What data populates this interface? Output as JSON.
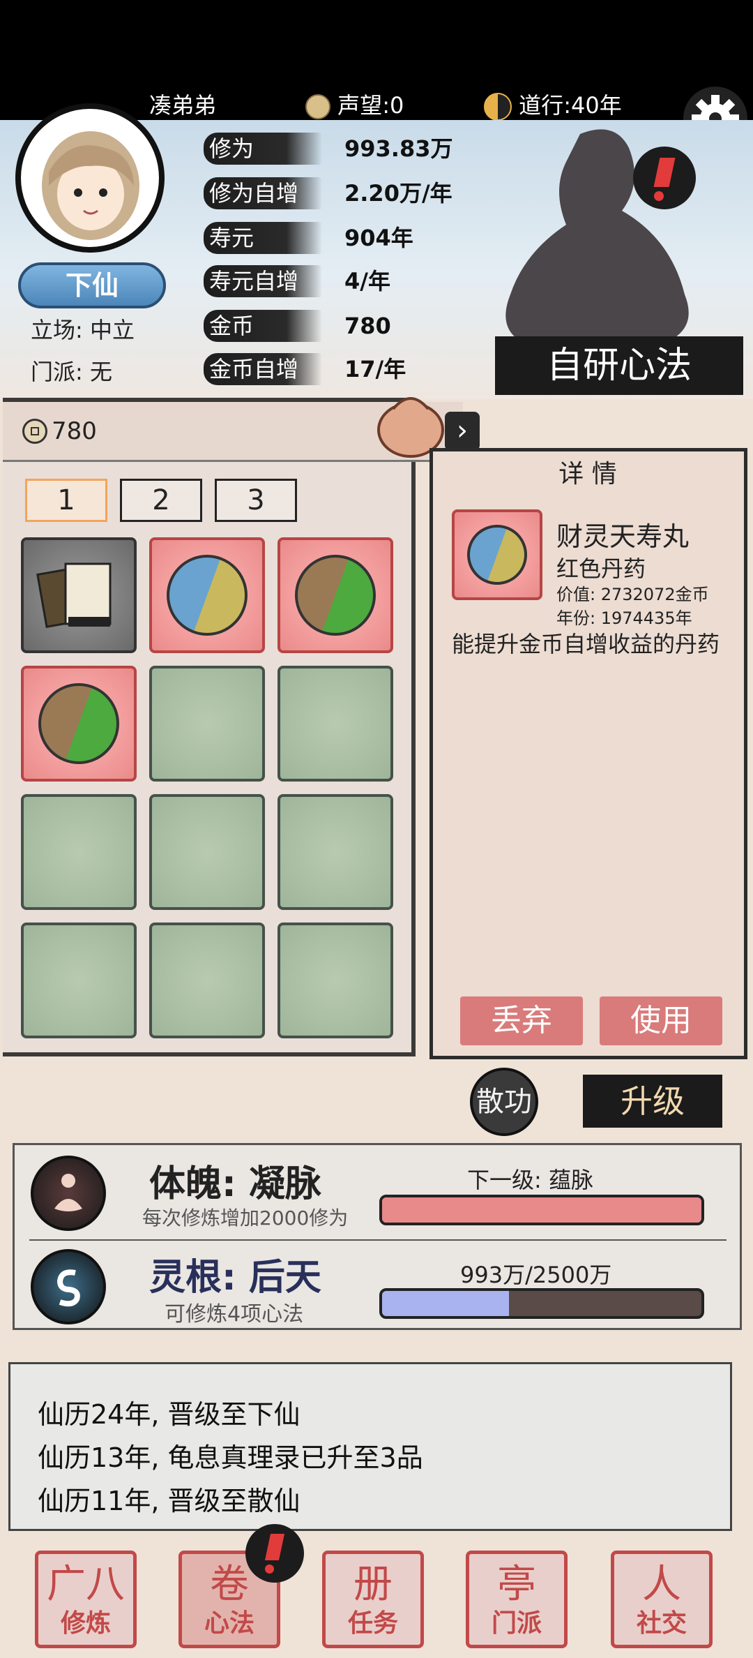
{
  "top": {
    "player_name": "凑弟弟",
    "reputation_label": "声望",
    "reputation_value": ":0",
    "dao_label": "道行",
    "dao_value": ":40年"
  },
  "profile": {
    "rank_badge": "下仙",
    "stance": "立场: 中立",
    "sect": "门派: 无"
  },
  "stats": [
    {
      "label": "修为",
      "value": "993.83万"
    },
    {
      "label": "修为自增",
      "value": "2.20万/年"
    },
    {
      "label": "寿元",
      "value": "904年"
    },
    {
      "label": "寿元自增",
      "value": "4/年"
    },
    {
      "label": "金币",
      "value": "780"
    },
    {
      "label": "金币自增",
      "value": "17/年"
    }
  ],
  "self_study_button": "自研心法",
  "inventory": {
    "coin_count": "780",
    "tabs": [
      "1",
      "2",
      "3"
    ],
    "active_tab": "1"
  },
  "detail": {
    "title": "详 情",
    "item_name": "财灵天寿丸",
    "item_type": "红色丹药",
    "price": "价值: 2732072金币",
    "age": "年份: 1974435年",
    "description": "能提升金币自增收益的丹药",
    "discard_button": "丢弃",
    "use_button": "使用"
  },
  "actions": {
    "disperse_button": "散功",
    "upgrade_button": "升级"
  },
  "body": {
    "title": "体魄: 凝脉",
    "subtitle": "每次修炼增加2000修为",
    "next_label": "下一级: 蕴脉",
    "progress": 1.0
  },
  "root": {
    "title": "灵根: 后天",
    "subtitle": "可修炼4项心法",
    "progress_text": "993万/2500万",
    "progress": 0.397
  },
  "log": [
    "仙历24年, 晋级至下仙",
    "仙历13年, 龟息真理录已升至3品",
    "仙历11年, 晋级至散仙"
  ],
  "nav": [
    {
      "label": "修炼",
      "icon": "广八"
    },
    {
      "label": "心法",
      "icon": "卷"
    },
    {
      "label": "任务",
      "icon": "册"
    },
    {
      "label": "门派",
      "icon": "亭"
    },
    {
      "label": "社交",
      "icon": "人"
    }
  ],
  "colors": {
    "accent_red": "#d97b7b",
    "progress_red": "#e8898a",
    "progress_blue": "#a9b3ef",
    "progress_dark": "#5a4b48"
  }
}
